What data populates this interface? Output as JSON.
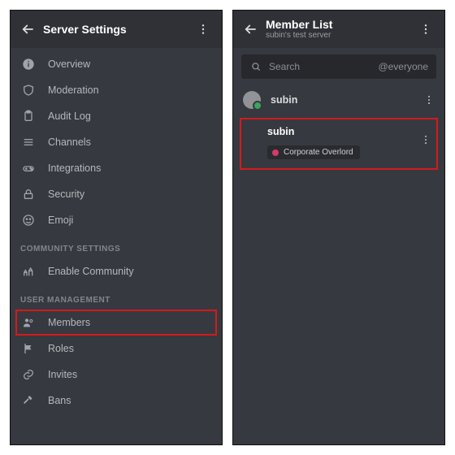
{
  "left": {
    "header_title": "Server Settings",
    "items": [
      {
        "label": "Overview"
      },
      {
        "label": "Moderation"
      },
      {
        "label": "Audit Log"
      },
      {
        "label": "Channels"
      },
      {
        "label": "Integrations"
      },
      {
        "label": "Security"
      },
      {
        "label": "Emoji"
      }
    ],
    "section_community": "COMMUNITY SETTINGS",
    "community_item": "Enable Community",
    "section_user_mgmt": "USER MANAGEMENT",
    "user_items": {
      "members": "Members",
      "roles": "Roles",
      "invites": "Invites",
      "bans": "Bans"
    }
  },
  "right": {
    "header_title": "Member List",
    "header_subtitle": "subin's test server",
    "search_placeholder": "Search",
    "filter_chip": "@everyone",
    "member_name": "subin",
    "selected_member_name": "subin",
    "selected_member_role": "Corporate Overlord"
  }
}
